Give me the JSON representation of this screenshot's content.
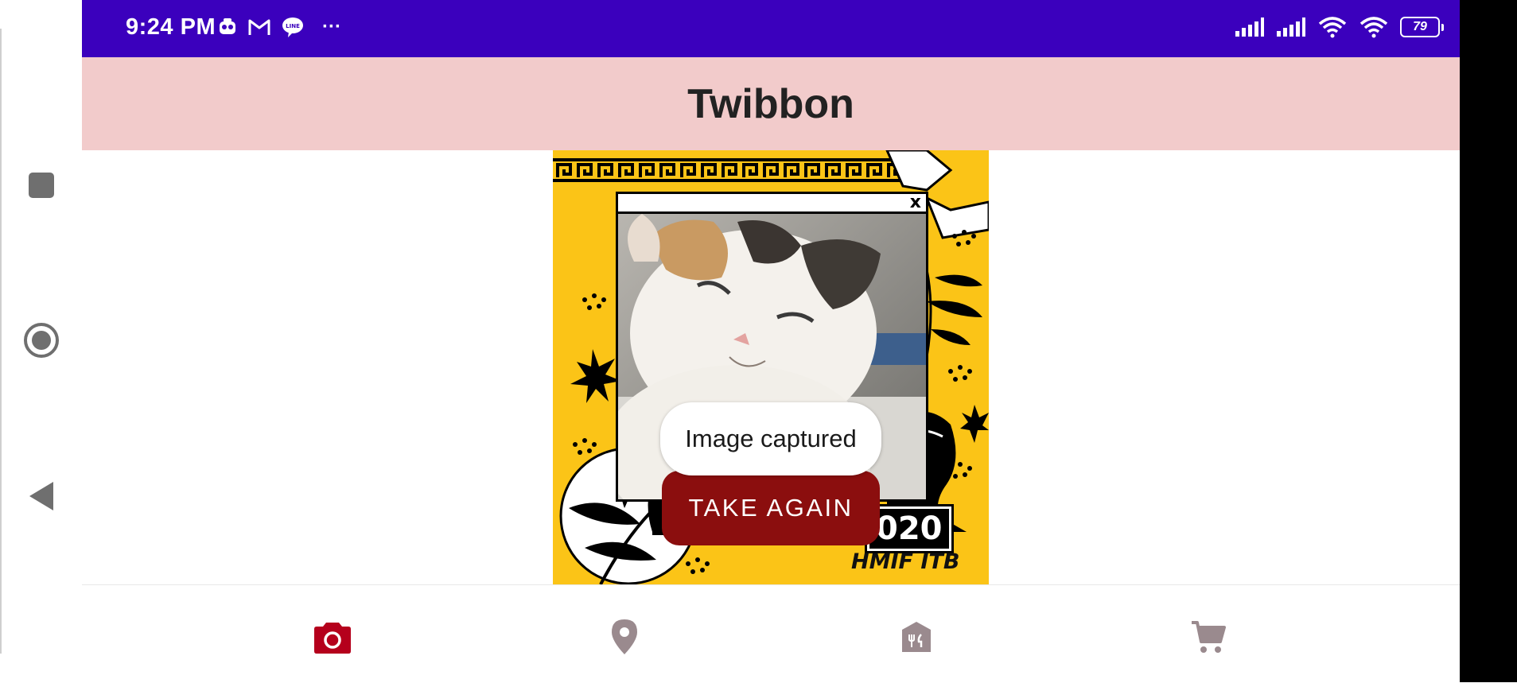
{
  "status_bar": {
    "time": "9:24 PM",
    "left_icons": [
      "mascot-notification-icon",
      "gmail-icon",
      "line-icon",
      "more-dots-icon"
    ],
    "more_label": "···",
    "battery_level": "79",
    "right_icons": [
      "signal-icon",
      "signal-icon",
      "wifi-icon",
      "wifi-icon",
      "battery-icon"
    ]
  },
  "nav_rail": {
    "items": [
      "recents-icon",
      "home-icon",
      "back-icon"
    ]
  },
  "app_bar": {
    "title": "Twibbon"
  },
  "twibbon": {
    "window_close": "x",
    "year_text": "020",
    "org_text": "HMIF ITB"
  },
  "toast": {
    "message": "Image captured"
  },
  "actions": {
    "take_again_label": "TAKE AGAIN"
  },
  "bottom_nav": {
    "items": [
      {
        "icon": "camera-icon",
        "active": true
      },
      {
        "icon": "location-pin-icon",
        "active": false
      },
      {
        "icon": "restaurant-icon",
        "active": false
      },
      {
        "icon": "cart-icon",
        "active": false
      }
    ]
  },
  "colors": {
    "status_bar": "#3b00bd",
    "app_bar": "#f2cbcb",
    "accent": "#b5001c",
    "button": "#8b0e0e",
    "inactive_icon": "#9a8a8e",
    "twibbon_yellow": "#fbc417"
  }
}
